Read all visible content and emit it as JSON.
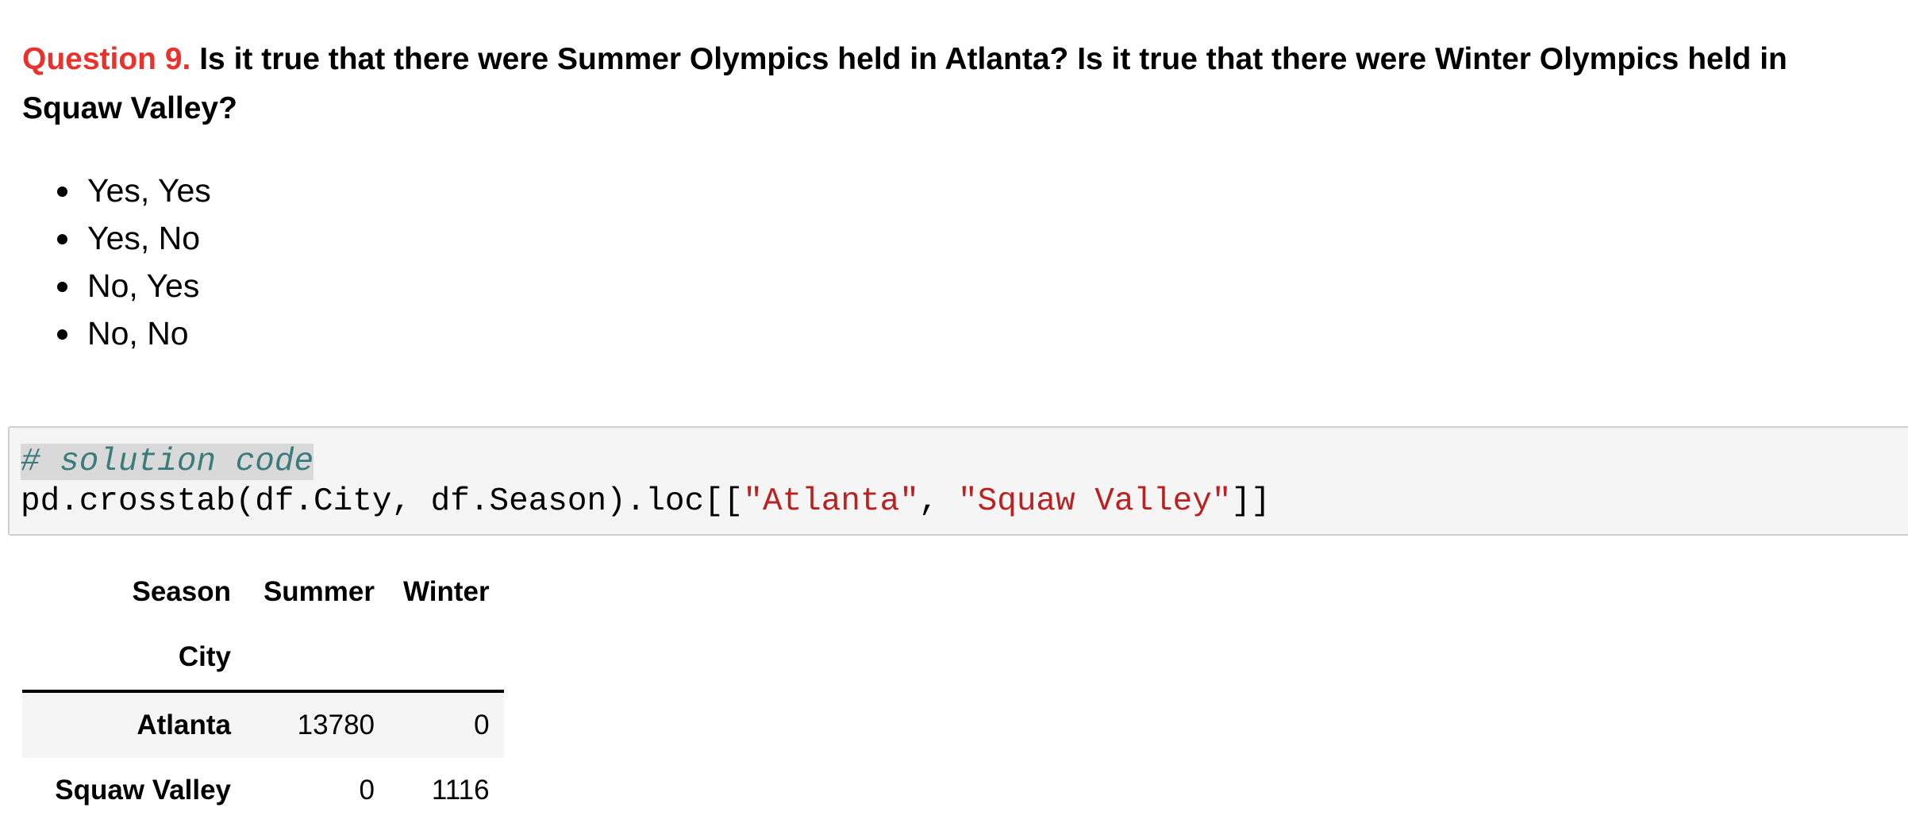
{
  "question": {
    "label": "Question 9.",
    "text": "Is it true that there were Summer Olympics held in Atlanta? Is it true that there were Winter Olympics held in Squaw Valley?"
  },
  "options": [
    "Yes, Yes",
    "Yes, No",
    "No, Yes",
    "No, No"
  ],
  "code_cell": {
    "comment": "# solution code",
    "line2_prefix": "pd.crosstab(df.City, df.Season).loc[[",
    "string1": "\"Atlanta\"",
    "separator": ", ",
    "string2": "\"Squaw Valley\"",
    "line2_suffix": "]]"
  },
  "output_table": {
    "columns_name": "Season",
    "columns": [
      "Summer",
      "Winter"
    ],
    "index_name": "City",
    "rows": [
      {
        "index": "Atlanta",
        "values": [
          "13780",
          "0"
        ]
      },
      {
        "index": "Squaw Valley",
        "values": [
          "0",
          "1116"
        ]
      }
    ]
  },
  "colors": {
    "question_label": "#e8322b",
    "comment": "#3b7b7b",
    "string": "#ba2121",
    "code_background": "#f5f5f5"
  }
}
